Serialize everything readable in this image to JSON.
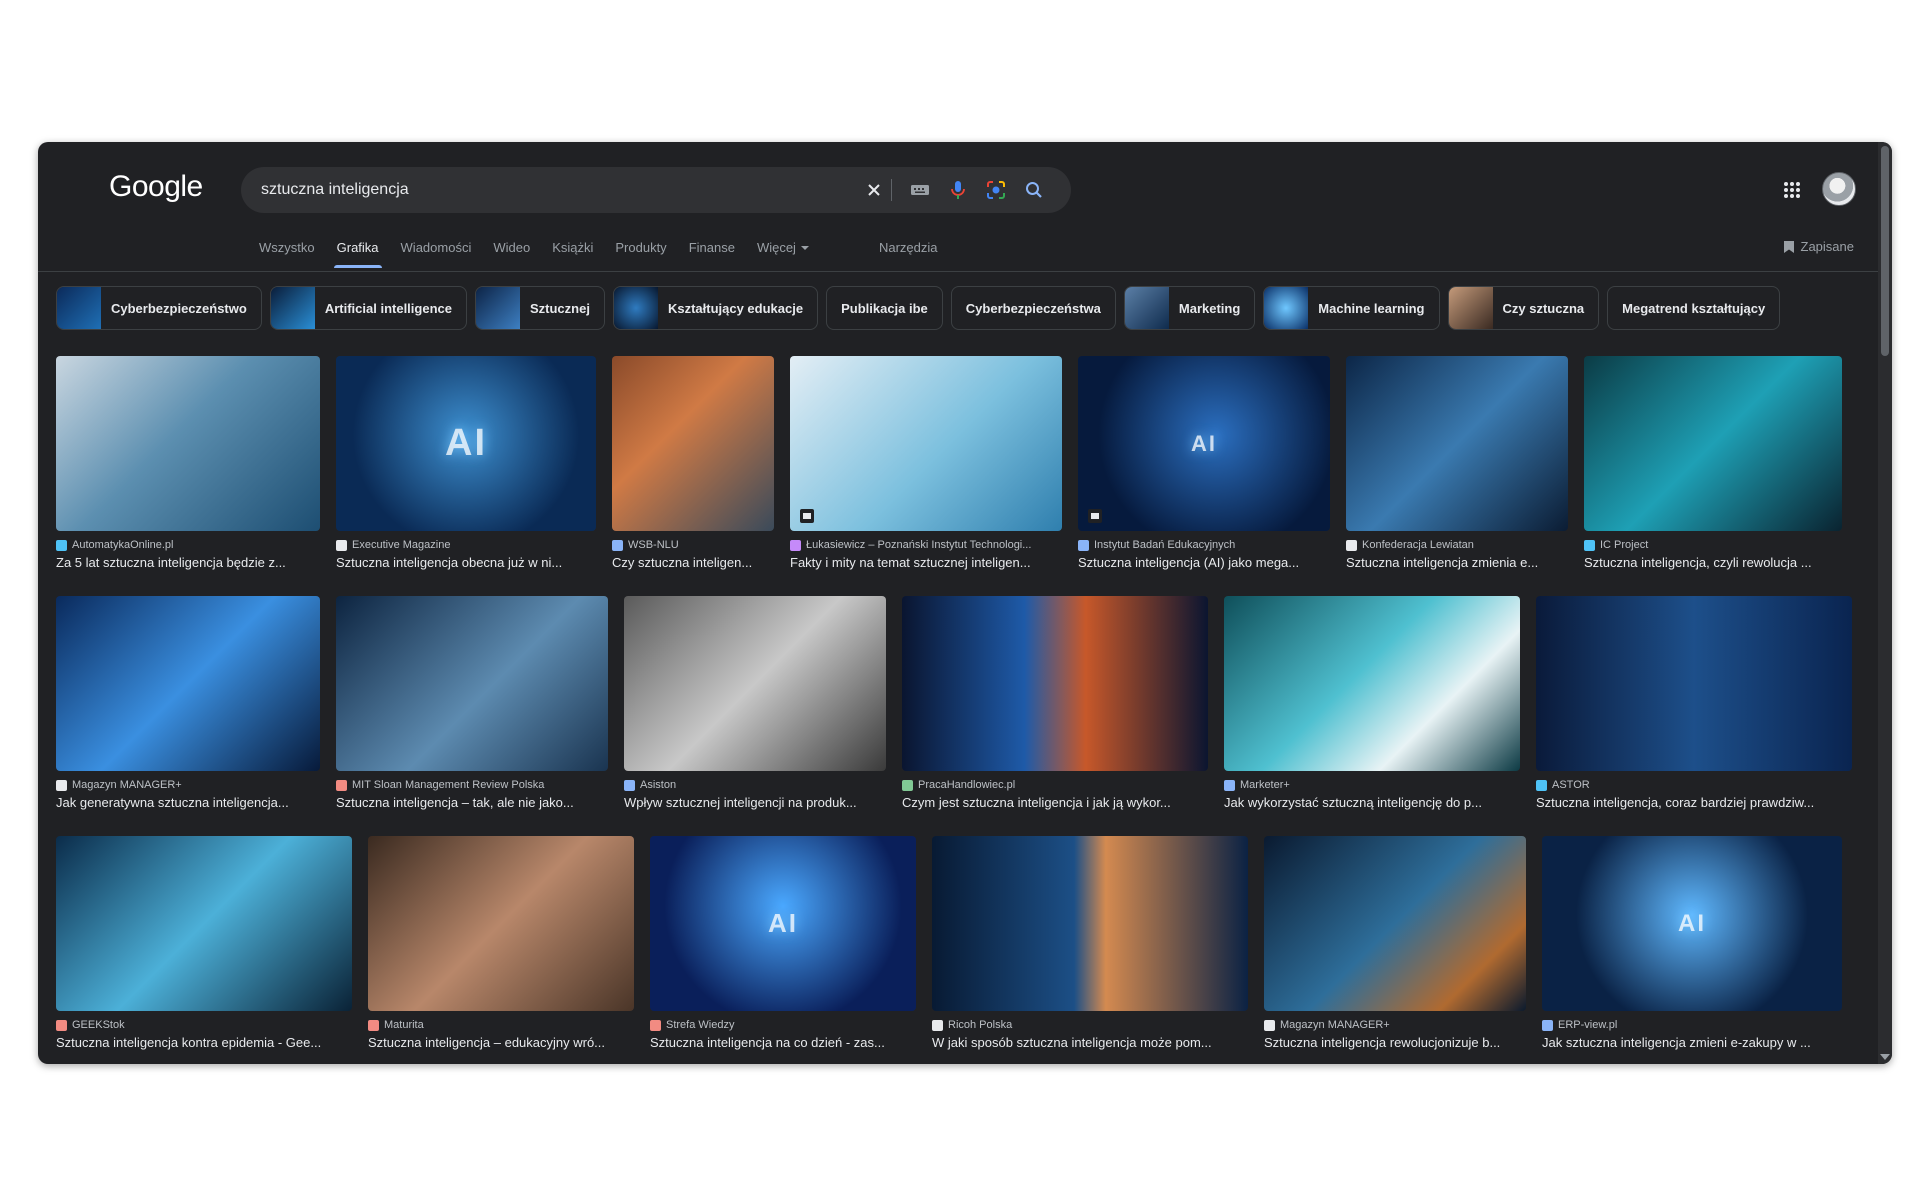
{
  "header": {
    "logo": "Google",
    "search": {
      "query": "sztuczna inteligencja",
      "icons": [
        "close-icon",
        "keyboard-icon",
        "microphone-icon",
        "lens-icon",
        "search-icon"
      ]
    },
    "apps_icon": "apps-grid-icon",
    "saved_label": "Zapisane"
  },
  "nav": {
    "tabs": [
      "Wszystko",
      "Grafika",
      "Wiadomości",
      "Wideo",
      "Książki",
      "Produkty",
      "Finanse",
      "Więcej"
    ],
    "active": "Grafika",
    "tools_label": "Narzędzia"
  },
  "chips": [
    "Cyberbezpieczeństwo",
    "Artificial intelligence",
    "Sztucznej",
    "Kształtujący edukacje",
    "Publikacja ibe",
    "Cyberbezpieczeństwa",
    "Marketing",
    "Machine learning",
    "Czy sztuczna",
    "Megatrend kształtujący"
  ],
  "results": [
    [
      {
        "source": "AutomatykaOnline.pl",
        "title": "Za 5 lat sztuczna inteligencja będzie z..."
      },
      {
        "source": "Executive Magazine",
        "title": "Sztuczna inteligencja obecna już w ni...",
        "art": "AI"
      },
      {
        "source": "WSB-NLU",
        "title": "Czy sztuczna inteligen..."
      },
      {
        "source": "Łukasiewicz – Poznański Instytut Technologi...",
        "title": "Fakty i mity na temat sztucznej inteligen..."
      },
      {
        "source": "Instytut Badań Edukacyjnych",
        "title": "Sztuczna inteligencja (AI) jako mega...",
        "art": "AI"
      },
      {
        "source": "Konfederacja Lewiatan",
        "title": "Sztuczna inteligencja zmienia e..."
      },
      {
        "source": "IC Project",
        "title": "Sztuczna inteligencja, czyli rewolucja ..."
      }
    ],
    [
      {
        "source": "Magazyn MANAGER+",
        "title": "Jak generatywna sztuczna inteligencja..."
      },
      {
        "source": "MIT Sloan Management Review Polska",
        "title": "Sztuczna inteligencja – tak, ale nie jako..."
      },
      {
        "source": "Asiston",
        "title": "Wpływ sztucznej inteligencji na produk..."
      },
      {
        "source": "PracaHandlowiec.pl",
        "title": "Czym jest sztuczna inteligencja i jak ją wykor..."
      },
      {
        "source": "Marketer+",
        "title": "Jak wykorzystać sztuczną inteligencję do p..."
      },
      {
        "source": "ASTOR",
        "title": "Sztuczna inteligencja, coraz bardziej prawdziw..."
      }
    ],
    [
      {
        "source": "GEEKStok",
        "title": "Sztuczna inteligencja kontra epidemia - Gee..."
      },
      {
        "source": "Maturita",
        "title": "Sztuczna inteligencja – edukacyjny wró..."
      },
      {
        "source": "Strefa Wiedzy",
        "title": "Sztuczna inteligencja na co dzień - zas...",
        "art": "AI"
      },
      {
        "source": "Ricoh Polska",
        "title": "W jaki sposób sztuczna inteligencja może pom..."
      },
      {
        "source": "Magazyn MANAGER+",
        "title": "Sztuczna inteligencja rewolucjonizuje b..."
      },
      {
        "source": "ERP-view.pl",
        "title": "Jak sztuczna inteligencja zmieni e-zakupy w ...",
        "art": "AI"
      }
    ]
  ]
}
